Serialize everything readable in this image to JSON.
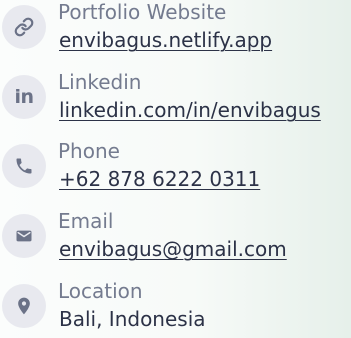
{
  "contacts": [
    {
      "label": "Portfolio Website",
      "value": "envibagus.netlify.app",
      "icon": "link-icon"
    },
    {
      "label": "Linkedin",
      "value": "linkedin.com/in/envibagus",
      "icon": "linkedin-icon",
      "icon_text": "in"
    },
    {
      "label": "Phone",
      "value": "+62 878 6222 0311",
      "icon": "phone-icon"
    },
    {
      "label": "Email",
      "value": "envibagus@gmail.com",
      "icon": "mail-icon"
    },
    {
      "label": "Location",
      "value": "Bali, Indonesia",
      "icon": "location-pin-icon"
    }
  ],
  "colors": {
    "icon_bg": "#e8e9ef",
    "icon_fg": "#6b7287",
    "label": "#747b8f",
    "value": "#2c3247"
  }
}
